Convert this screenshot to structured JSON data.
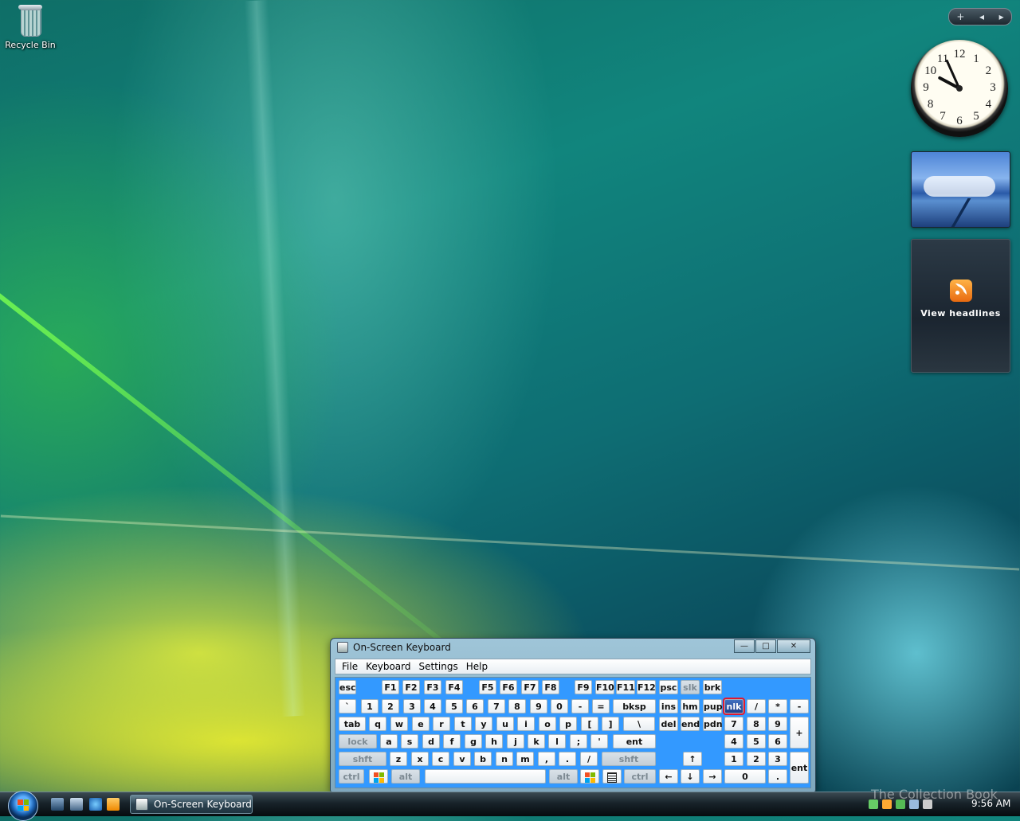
{
  "desktop": {
    "recycle_bin_label": "Recycle Bin"
  },
  "sidebar": {
    "add_symbol": "+",
    "prev_symbol": "◂",
    "next_symbol": "▸",
    "clock": {
      "numbers": [
        "12",
        "1",
        "2",
        "3",
        "4",
        "5",
        "6",
        "7",
        "8",
        "9",
        "10",
        "11"
      ],
      "time": "9:56"
    },
    "feeds": {
      "label": "View headlines",
      "icon": "rss-icon"
    }
  },
  "osk": {
    "title": "On-Screen Keyboard",
    "menu": [
      "File",
      "Keyboard",
      "Settings",
      "Help"
    ],
    "keys": {
      "row0": [
        "esc",
        "F1",
        "F2",
        "F3",
        "F4",
        "F5",
        "F6",
        "F7",
        "F8",
        "F9",
        "F10",
        "F11",
        "F12",
        "psc",
        "slk",
        "brk"
      ],
      "row1": [
        "`",
        "1",
        "2",
        "3",
        "4",
        "5",
        "6",
        "7",
        "8",
        "9",
        "0",
        "-",
        "=",
        "bksp",
        "ins",
        "hm",
        "pup",
        "nlk",
        "/",
        "*",
        "-"
      ],
      "row2": [
        "tab",
        "q",
        "w",
        "e",
        "r",
        "t",
        "y",
        "u",
        "i",
        "o",
        "p",
        "[",
        "]",
        "\\",
        "del",
        "end",
        "pdn",
        "7",
        "8",
        "9",
        "+"
      ],
      "row3": [
        "lock",
        "a",
        "s",
        "d",
        "f",
        "g",
        "h",
        "j",
        "k",
        "l",
        ";",
        "'",
        "ent",
        "4",
        "5",
        "6"
      ],
      "row4": [
        "shft",
        "z",
        "x",
        "c",
        "v",
        "b",
        "n",
        "m",
        ",",
        ".",
        "/",
        "shft",
        "↑",
        "1",
        "2",
        "3",
        "ent"
      ],
      "row5": [
        "ctrl",
        "",
        "alt",
        "",
        "alt",
        "",
        "",
        "ctrl",
        "←",
        "↓",
        "→",
        "0",
        "."
      ]
    },
    "active_key": "nlk"
  },
  "taskbar": {
    "task_label": "On-Screen Keyboard",
    "time": "9:56 AM"
  },
  "watermark": "The Collection Book",
  "colors": {
    "keyboard_bg": "#3399ff",
    "active_key_outline": "#e01830"
  }
}
